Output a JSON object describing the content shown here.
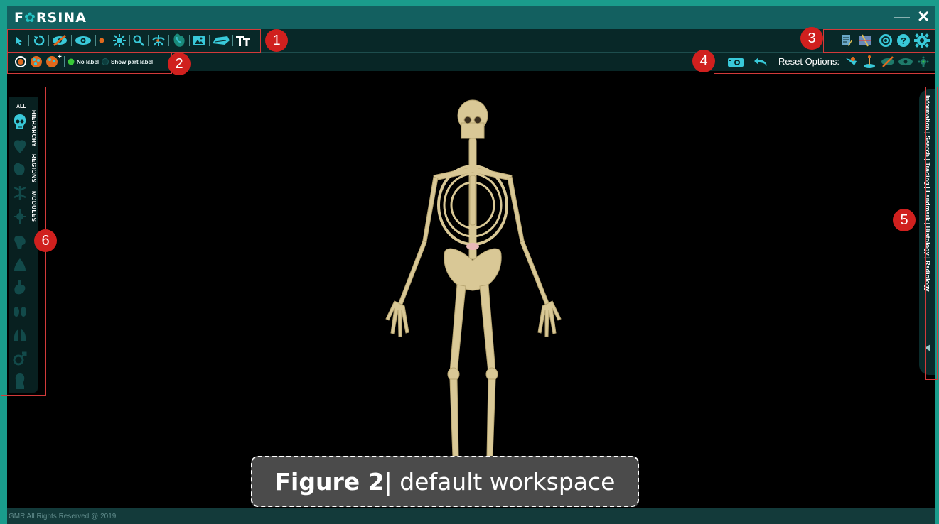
{
  "app": {
    "logo_prefix": "F",
    "logo_gear": "✿",
    "logo_suffix": "RSINA"
  },
  "window": {
    "minimize_icon": "—",
    "close_icon": "✕"
  },
  "toolbar1": {
    "icons": [
      "select-arrow-icon",
      "rotate-icon",
      "hide-icon",
      "show-icon",
      "point-icon",
      "explode-icon",
      "zoom-icon",
      "nerve-icon",
      "organ-icon",
      "image-icon",
      "layer-icon",
      "text-icon"
    ]
  },
  "toolbar3": {
    "icons": [
      "notes-icon",
      "annotate-icon",
      "sync-icon",
      "help-icon",
      "settings-icon"
    ]
  },
  "toolbar2": {
    "radio_no_label": "No label",
    "radio_show_part_label": "Show part label",
    "selected": "No label"
  },
  "toolbar4": {
    "reset_label": "Reset Options:"
  },
  "badges": {
    "b1": "1",
    "b2": "2",
    "b3": "3",
    "b4": "4",
    "b5": "5",
    "b6": "6"
  },
  "left_panel": {
    "all_label": "ALL",
    "tabs": [
      "HIERARCHY",
      "REGIONS",
      "MODULES"
    ],
    "icons": [
      "skull-icon",
      "muscle-icon",
      "heart-icon",
      "nerve-icon",
      "lymph-icon",
      "brain-icon",
      "lung-icon",
      "stomach-icon",
      "kidney-icon",
      "lungs-icon",
      "male-icon",
      "head-icon"
    ]
  },
  "right_panel": {
    "text": "Information  |  Search  |  Tracing  |  Landmark  |  Histology  |  Radiology"
  },
  "caption": {
    "bold": "Figure 2",
    "rest": " | default workspace"
  },
  "footer": {
    "copyright": "GMR All Rights Reserved @ 2019"
  },
  "colors": {
    "accent": "#39c9d9",
    "title_bar": "#136060",
    "frame": "#1a9c8c",
    "badge": "#d0201e"
  }
}
